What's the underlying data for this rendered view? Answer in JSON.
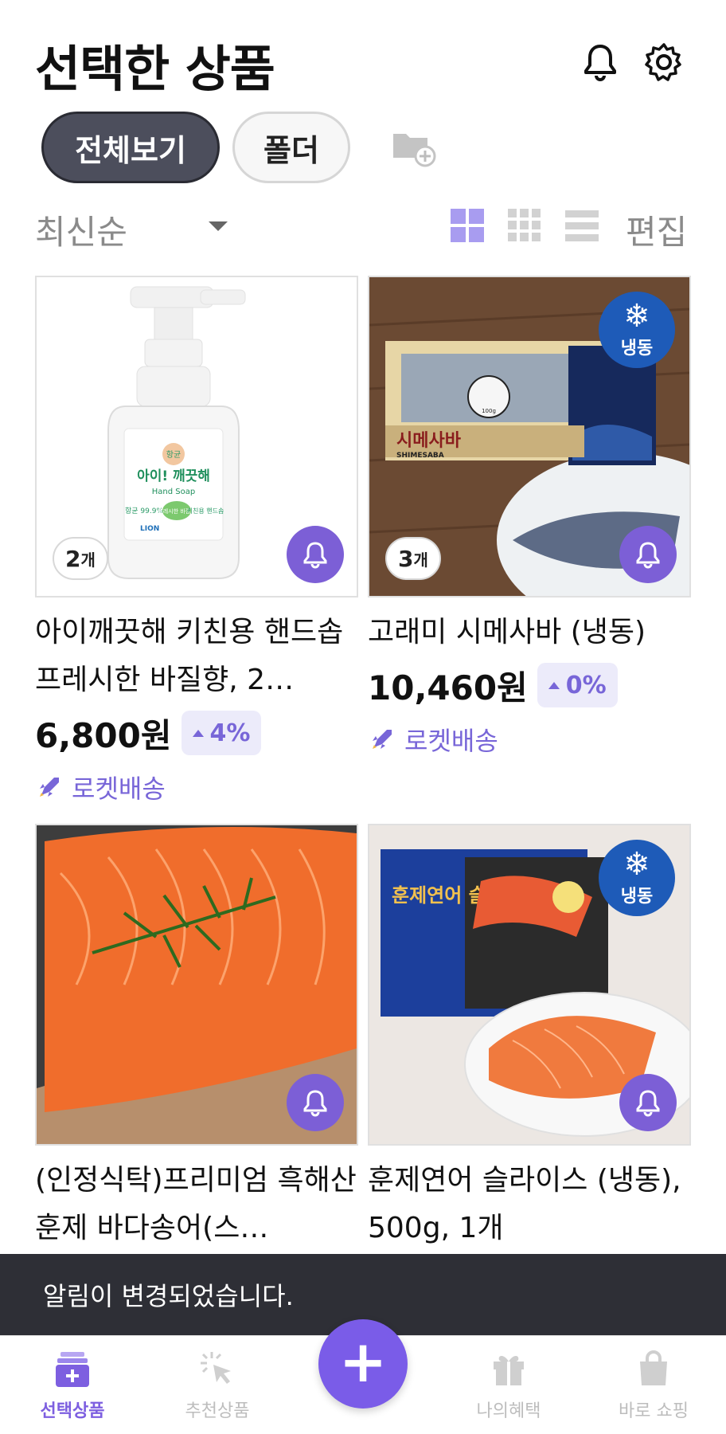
{
  "header": {
    "title": "선택한 상품",
    "bell_icon": "bell-icon",
    "settings_icon": "gear-icon"
  },
  "filters": {
    "all_label": "전체보기",
    "folder_label": "폴더",
    "add_folder_icon": "folder-add-icon"
  },
  "sortbar": {
    "sort_label": "최신순",
    "view_icons": [
      "grid-large-icon",
      "grid-small-icon",
      "list-icon"
    ],
    "edit_label": "편집"
  },
  "products": [
    {
      "name": "아이깨끗해 키친용 핸드솝 프레시한 바질향, 2…",
      "count": "2",
      "count_unit": "개",
      "price": "6,800원",
      "change": "4%",
      "delivery": "로켓배송",
      "frozen": false,
      "image_text": {
        "brand_small": "항균",
        "brand": "아이! 깨끗해",
        "sub": "Hand Soap",
        "tag1": "항균 99.9%",
        "tag2": "프레시한 바질향",
        "tag3": "키친용 핸드솝",
        "maker": "LION"
      }
    },
    {
      "name": "고래미 시메사바 (냉동)",
      "count": "3",
      "count_unit": "개",
      "price": "10,460원",
      "change": "0%",
      "delivery": "로켓배송",
      "frozen": true,
      "frozen_label": "냉동",
      "image_text": {
        "label": "시메사바",
        "sub": "SHIMESABA",
        "weight": "100g"
      }
    },
    {
      "name": "(인정식탁)프리미엄 흑해산 훈제 바다송어(스…",
      "frozen": false
    },
    {
      "name": "훈제연어 슬라이스 (냉동), 500g, 1개",
      "frozen": true,
      "frozen_label": "냉동",
      "image_text": {
        "label": "훈제연어 슬라이스"
      }
    }
  ],
  "toast": "알림이 변경되었습니다.",
  "bottom_nav": {
    "items": [
      {
        "label": "선택상품",
        "icon": "basket-icon",
        "active": true
      },
      {
        "label": "추천상품",
        "icon": "pointer-sparkle-icon",
        "active": false
      },
      {
        "label": "나의혜택",
        "icon": "gift-icon",
        "active": false
      },
      {
        "label": "바로 쇼핑",
        "icon": "shopping-bag-icon",
        "active": false
      }
    ],
    "fab_label": "+"
  },
  "colors": {
    "accent": "#7c5fd6",
    "chip_active": "#4c4e5c",
    "change_bg": "#ecebfa",
    "toast_bg": "#2e2f36",
    "frozen_badge": "#1e5bb8"
  }
}
